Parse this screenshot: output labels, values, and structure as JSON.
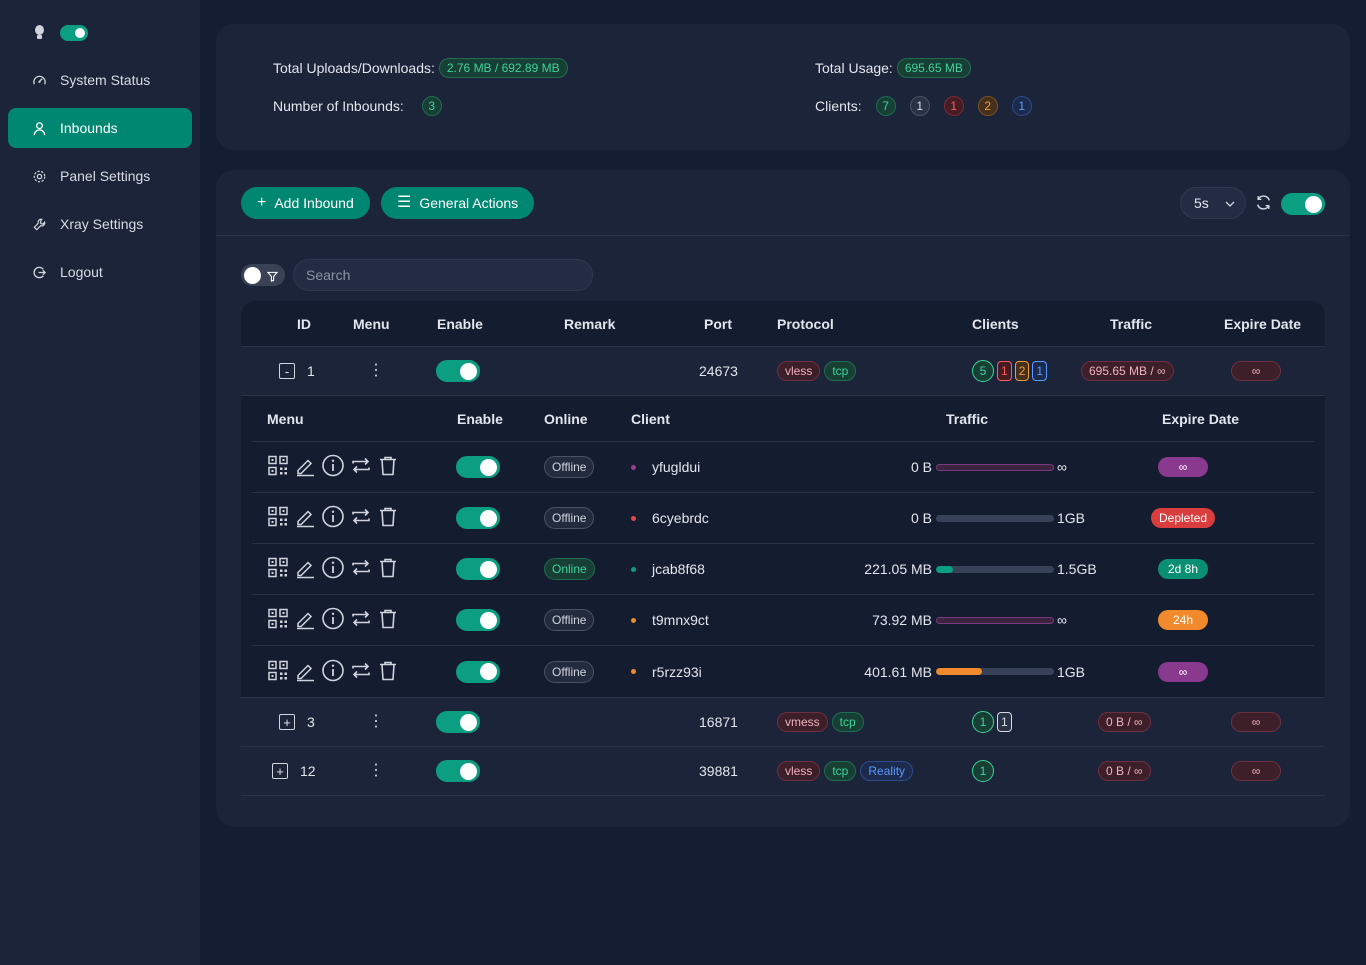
{
  "sidebar": {
    "items": [
      {
        "label": "System Status",
        "icon": "dashboard-icon"
      },
      {
        "label": "Inbounds",
        "icon": "user-icon",
        "active": true
      },
      {
        "label": "Panel Settings",
        "icon": "gear-icon"
      },
      {
        "label": "Xray Settings",
        "icon": "wrench-icon"
      },
      {
        "label": "Logout",
        "icon": "logout-icon"
      }
    ]
  },
  "summary": {
    "uploads_label": "Total Uploads/Downloads:",
    "uploads_value": "2.76 MB / 692.89 MB",
    "usage_label": "Total Usage:",
    "usage_value": "695.65 MB",
    "inbounds_label": "Number of Inbounds:",
    "inbounds_value": "3",
    "clients_label": "Clients:",
    "clients": [
      "7",
      "1",
      "1",
      "2",
      "1"
    ]
  },
  "toolbar": {
    "add_label": "Add Inbound",
    "general_label": "General Actions",
    "refresh_interval": "5s",
    "search_placeholder": "Search"
  },
  "table": {
    "headers": [
      "ID",
      "Menu",
      "Enable",
      "Remark",
      "Port",
      "Protocol",
      "Clients",
      "Traffic",
      "Expire Date"
    ],
    "inbounds": [
      {
        "expander": "-",
        "id": "1",
        "port": "24673",
        "protocols": [
          "vless",
          "tcp"
        ],
        "clients": [
          "5",
          "1",
          "2",
          "1"
        ],
        "traffic": "695.65 MB / ∞",
        "expire": "∞"
      },
      {
        "expander": "+",
        "id": "3",
        "port": "16871",
        "protocols": [
          "vmess",
          "tcp"
        ],
        "clients": [
          "1",
          "1"
        ],
        "traffic": "0 B / ∞",
        "expire": "∞"
      },
      {
        "expander": "+",
        "id": "12",
        "port": "39881",
        "protocols": [
          "vless",
          "tcp",
          "Reality"
        ],
        "clients": [
          "1"
        ],
        "traffic": "0 B / ∞",
        "expire": "∞"
      }
    ]
  },
  "clients_table": {
    "headers": [
      "Menu",
      "Enable",
      "Online",
      "Client",
      "Traffic",
      "Expire Date"
    ],
    "rows": [
      {
        "status": "Offline",
        "name": "yfugldui",
        "used": "0 B",
        "total": "∞",
        "expire": "∞",
        "progress": 0,
        "dot_color": "#a23b8f",
        "expire_color": "#8a3a8e"
      },
      {
        "status": "Offline",
        "name": "6cyebrdc",
        "used": "0 B",
        "total": "1GB",
        "expire": "Depleted",
        "progress": 0,
        "dot_color": "#e04848",
        "expire_color": "#d93d3d"
      },
      {
        "status": "Online",
        "name": "jcab8f68",
        "used": "221.05 MB",
        "total": "1.5GB",
        "expire": "2d 8h",
        "progress": 14,
        "dot_color": "#0b9e80",
        "expire_color": "#0b8f72"
      },
      {
        "status": "Offline",
        "name": "t9mnx9ct",
        "used": "73.92 MB",
        "total": "∞",
        "expire": "24h",
        "progress": 0,
        "dot_color": "#f08a2c",
        "expire_color": "#f08a2c"
      },
      {
        "status": "Offline",
        "name": "r5rzz93i",
        "used": "401.61 MB",
        "total": "1GB",
        "expire": "∞",
        "progress": 39,
        "dot_color": "#f08a2c",
        "expire_color": "#8a3a8e"
      }
    ]
  },
  "colors": {
    "accent": "#008771",
    "background": "#151d33",
    "card": "#1b2439"
  }
}
